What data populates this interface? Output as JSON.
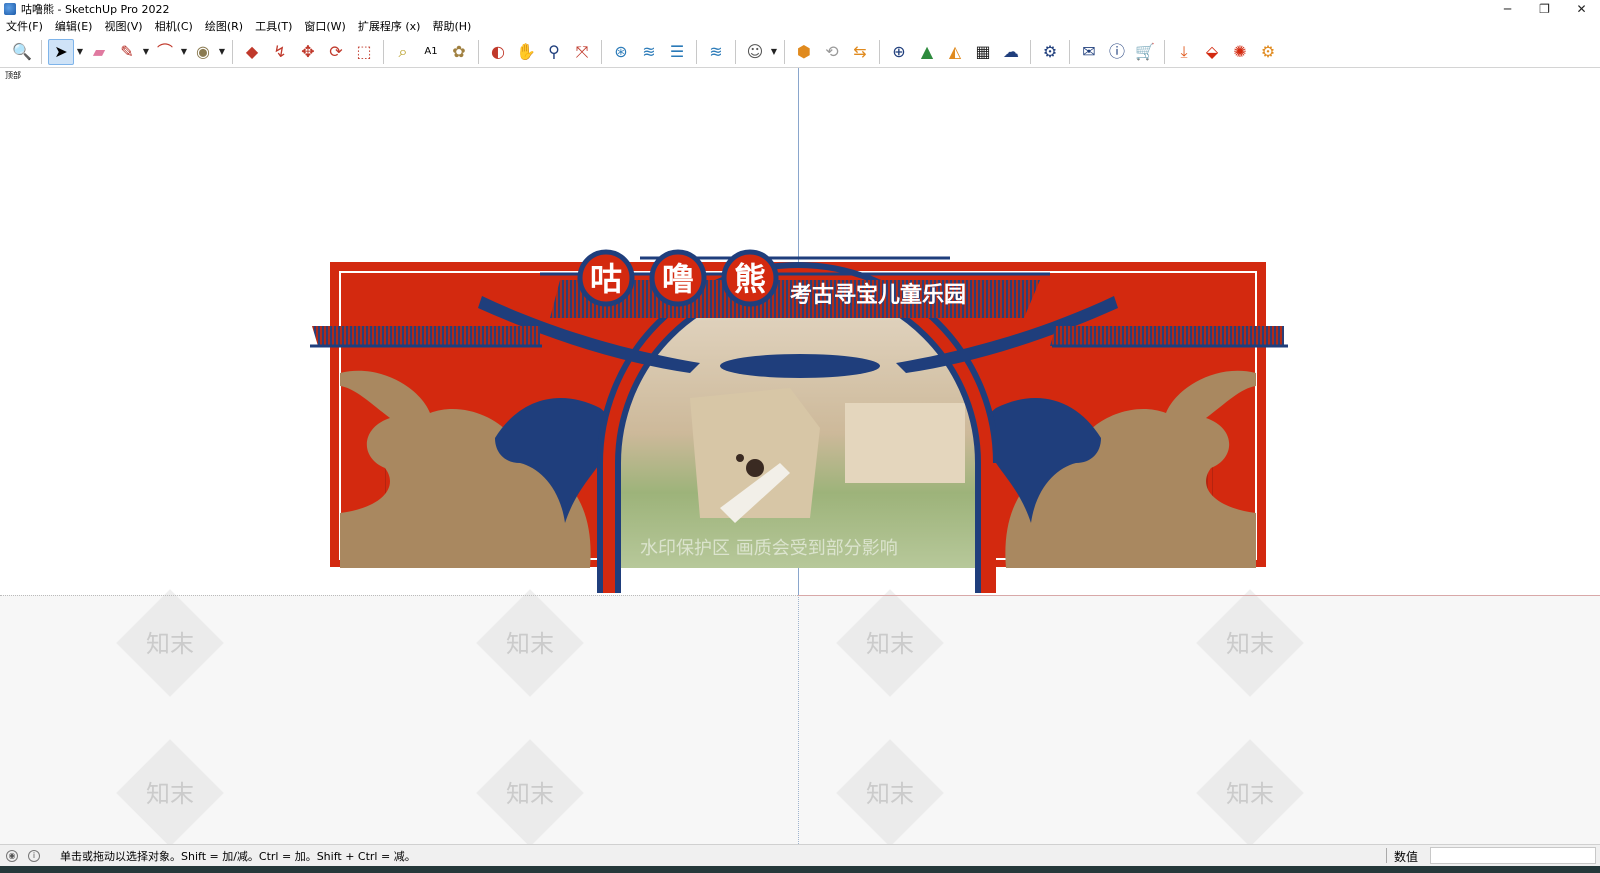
{
  "window": {
    "title": "咕噜熊 - SketchUp Pro 2022",
    "controls": {
      "minimize": "─",
      "restore": "❐",
      "close": "✕"
    }
  },
  "menubar": {
    "items": [
      "文件(F)",
      "编辑(E)",
      "视图(V)",
      "相机(C)",
      "绘图(R)",
      "工具(T)",
      "窗口(W)",
      "扩展程序 (x)",
      "帮助(H)"
    ]
  },
  "toolbar": {
    "icons": [
      "zoom-extents-icon",
      "select-icon",
      "eraser-icon",
      "pencil-icon",
      "arc-icon",
      "paint-bucket-icon",
      "push-pull-icon",
      "follow-me-icon",
      "move-icon",
      "rotate-icon",
      "scale-icon",
      "tape-measure-icon",
      "text-icon",
      "paint-icon",
      "orbit-icon",
      "pan-icon",
      "zoom-icon",
      "zoom-window-icon",
      "section-plane-icon",
      "section-display-icon",
      "layers-icon",
      "tags-icon",
      "profile-icon",
      "warehouse-icon",
      "refresh-icon",
      "export-icon",
      "add-location-icon",
      "tree-icon",
      "terrain-icon",
      "checker-icon",
      "cloud-upload-icon",
      "settings-icon",
      "mail-icon",
      "info-icon",
      "cart-icon",
      "download-icon",
      "extension-icon",
      "render-icon",
      "gear-icon"
    ]
  },
  "viewport": {
    "scene_label": "顶部",
    "model": {
      "logo_chars": [
        "咕",
        "噜",
        "熊"
      ],
      "subtitle": "考古寻宝儿童乐园",
      "watermark_overlay": "水印保护区  画质会受到部分影响",
      "watermark_tile": "知末"
    }
  },
  "statusbar": {
    "hint": "单击或拖动以选择对象。Shift = 加/减。Ctrl = 加。Shift + Ctrl = 减。",
    "value_label": "数值",
    "value": ""
  },
  "colors": {
    "red": "#d3290f",
    "navy": "#1f3e7c",
    "tan": "#a98860",
    "accent_active": "#cfe3f7"
  }
}
